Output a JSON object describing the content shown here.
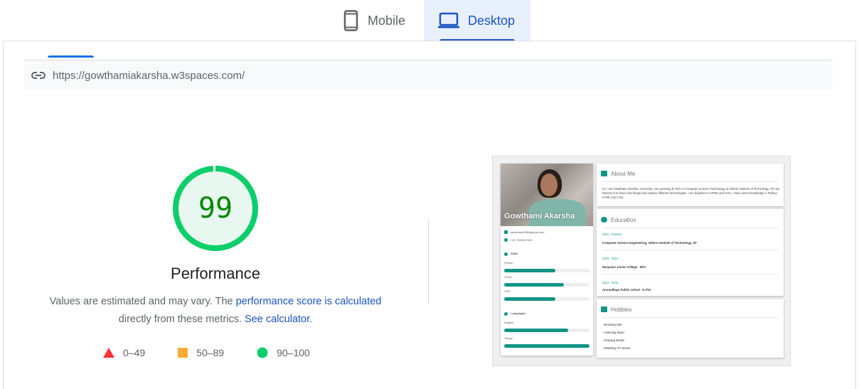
{
  "tabs": {
    "mobile_label": "Mobile",
    "desktop_label": "Desktop",
    "active": "Desktop"
  },
  "url": "https://gowthamiakarsha.w3spaces.com/",
  "score": {
    "value": "99",
    "fraction": 0.99,
    "color": "#0cce6b",
    "title": "Performance"
  },
  "description": {
    "text1": "Values are estimated and may vary. The ",
    "link1": "performance score is calculated",
    "text2": " directly from these metrics. ",
    "link2": "See calculator",
    "text3": "."
  },
  "legend": [
    {
      "range": "0–49",
      "shape": "triangle",
      "color": "#ff3333"
    },
    {
      "range": "50–89",
      "shape": "square",
      "color": "#ffaa33"
    },
    {
      "range": "90–100",
      "shape": "circle",
      "color": "#0cce6b"
    }
  ],
  "screenshot": {
    "name": "Gowthami Akarsha",
    "email": "sakarsha4008@gmail.com",
    "phone": "+91 7989937925",
    "skills_title": "Skills",
    "skills": [
      {
        "name": "Python",
        "label": "60%",
        "level": 0.6
      },
      {
        "name": "HTML",
        "label": "70%",
        "level": 0.7
      },
      {
        "name": "CSS",
        "label": "60%",
        "level": 0.6
      }
    ],
    "languages_title": "Languages",
    "languages": [
      {
        "name": "English",
        "level": 0.75
      },
      {
        "name": "Telugu",
        "level": 1.0
      }
    ],
    "about_title": "About Me",
    "about_text": "Hi, I am Gowthami Akarsha. Currently I am pursuing B.Tech in Computer Science Technology at Vellore Institute of Technology, AP. My interest is to learn new things and explore different technologies. I am beginner in HTML and CSS. I have some knowledge in Python, HTML and CSS.",
    "education_title": "Education",
    "education": [
      {
        "date": "2021 - Present",
        "text": "Computer Science Engineering, Vellore Institute of Technology, AP"
      },
      {
        "date": "2019 - 2021",
        "text": "Narayana Junior College - 92%"
      },
      {
        "date": "2014 - 2018",
        "text": "Arunodhaya Public school - 9.7/10"
      }
    ],
    "hobbies_title": "Hobbies",
    "hobbies": [
      "- Browsing Net",
      "- Listening Music",
      "- Reading Books",
      "- Watching TV Series"
    ],
    "accent": "#129486"
  }
}
